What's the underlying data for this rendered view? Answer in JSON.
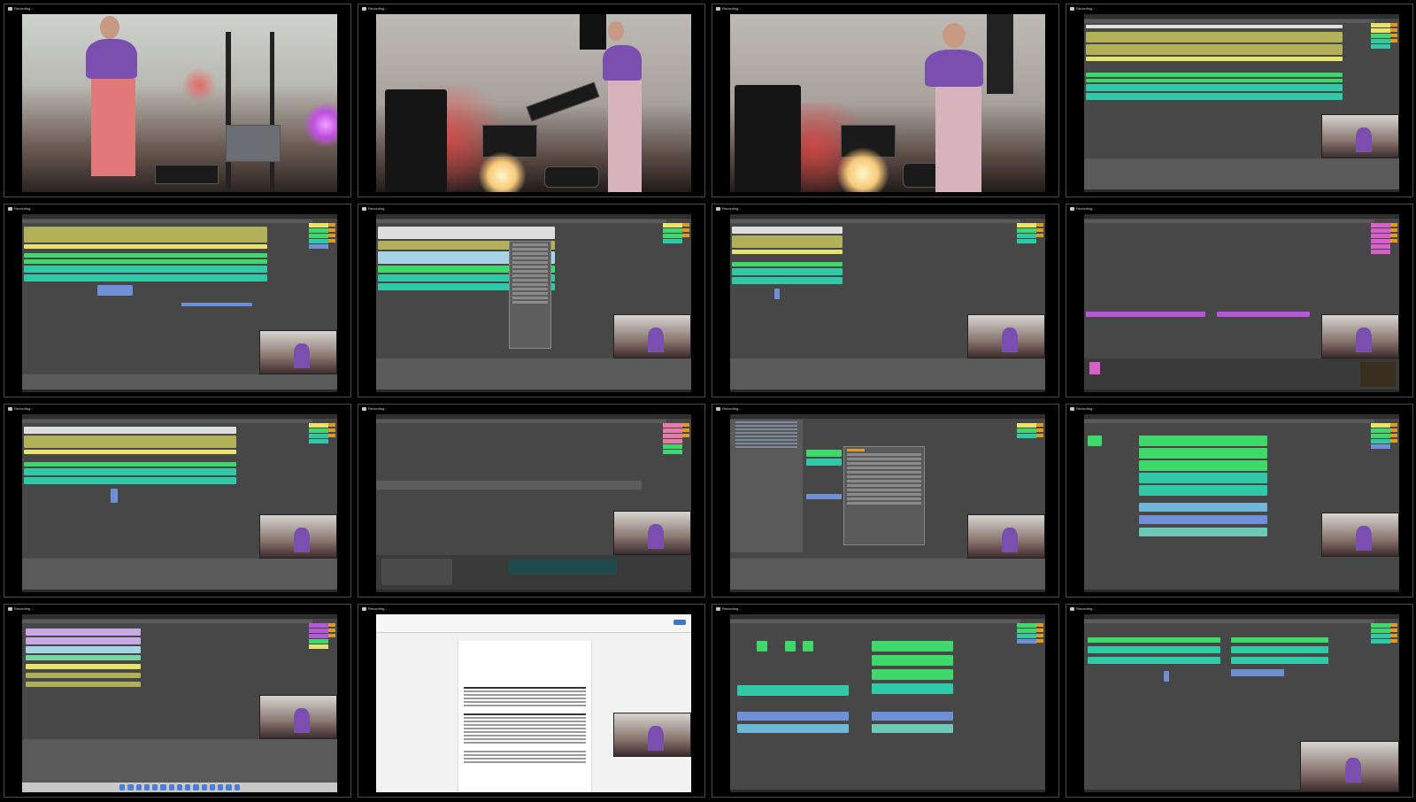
{
  "recording_badge": "Recording...",
  "colors": {
    "clip_olive": "#b3b05a",
    "clip_yellow": "#e8e36a",
    "clip_green": "#3fd86b",
    "clip_teal": "#2fc9a8",
    "clip_blue": "#6f8fd6",
    "clip_purple": "#b45ad8",
    "accent_orange": "#e09a28",
    "background": "#000000"
  },
  "tiles": [
    {
      "kind": "photo",
      "scene": "studio wide shot"
    },
    {
      "kind": "photo",
      "scene": "keyboard and pad controller"
    },
    {
      "kind": "photo",
      "scene": "pad controller close"
    },
    {
      "kind": "daw",
      "view": "arrangement"
    },
    {
      "kind": "daw",
      "view": "arrangement"
    },
    {
      "kind": "daw",
      "view": "arrangement with context menu"
    },
    {
      "kind": "daw",
      "view": "arrangement"
    },
    {
      "kind": "daw",
      "view": "arrangement with device view"
    },
    {
      "kind": "daw",
      "view": "arrangement"
    },
    {
      "kind": "daw",
      "view": "arrangement with clip view"
    },
    {
      "kind": "daw",
      "view": "browser with preferences dialog"
    },
    {
      "kind": "daw",
      "view": "arrangement"
    },
    {
      "kind": "daw",
      "view": "arrangement"
    },
    {
      "kind": "document",
      "view": "text document"
    },
    {
      "kind": "daw",
      "view": "arrangement"
    },
    {
      "kind": "daw",
      "view": "arrangement"
    }
  ]
}
